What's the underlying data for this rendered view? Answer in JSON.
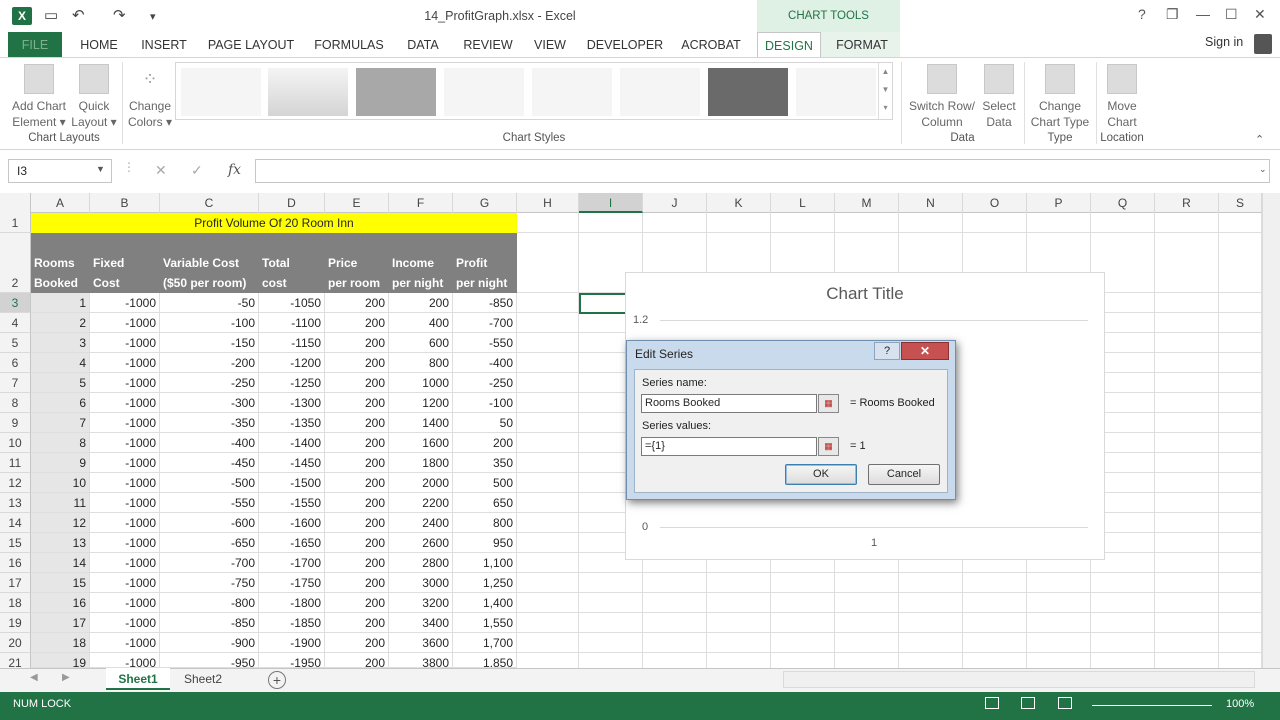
{
  "window": {
    "title": "14_ProfitGraph.xlsx - Excel",
    "chart_tools": "CHART TOOLS",
    "sign_in": "Sign in",
    "controls": {
      "help": "?",
      "restore": "❐",
      "minimize": "—",
      "maximize": "☐",
      "close": "✕"
    }
  },
  "qat": {
    "undo": "↶",
    "redo": "↷",
    "more": "▾",
    "save": "💾"
  },
  "tabs": [
    "FILE",
    "HOME",
    "INSERT",
    "PAGE LAYOUT",
    "FORMULAS",
    "DATA",
    "REVIEW",
    "VIEW",
    "DEVELOPER",
    "ACROBAT",
    "DESIGN",
    "FORMAT"
  ],
  "ribbon": {
    "add_chart": "Add Chart",
    "add_chart2": "Element ▾",
    "quick": "Quick",
    "quick2": "Layout ▾",
    "change": "Change",
    "change2": "Colors ▾",
    "group_layouts": "Chart Layouts",
    "group_styles": "Chart Styles",
    "switch": "Switch Row/",
    "switch2": "Column",
    "select": "Select",
    "select2": "Data",
    "group_data": "Data",
    "ctype": "Change",
    "ctype2": "Chart Type",
    "group_type": "Type",
    "move": "Move",
    "move2": "Chart",
    "group_location": "Location"
  },
  "formula": {
    "name_box": "I3",
    "cancel": "✕",
    "enter": "✓",
    "fx": "fx",
    "value": ""
  },
  "columns": [
    "A",
    "B",
    "C",
    "D",
    "E",
    "F",
    "G",
    "H",
    "I",
    "J",
    "K",
    "L",
    "M",
    "N",
    "O",
    "P",
    "Q",
    "R",
    "S"
  ],
  "sheet": {
    "title": "Profit Volume Of 20 Room Inn",
    "headers": [
      [
        "Rooms",
        "Booked"
      ],
      [
        "Fixed",
        "Cost"
      ],
      [
        "Variable Cost",
        "($50 per room)"
      ],
      [
        "Total",
        "cost"
      ],
      [
        "Price",
        "per room"
      ],
      [
        "Income",
        "per night"
      ],
      [
        "Profit",
        "per night"
      ]
    ],
    "rows": [
      [
        "1",
        "-1000",
        "-50",
        "-1050",
        "200",
        "200",
        "-850"
      ],
      [
        "2",
        "-1000",
        "-100",
        "-1100",
        "200",
        "400",
        "-700"
      ],
      [
        "3",
        "-1000",
        "-150",
        "-1150",
        "200",
        "600",
        "-550"
      ],
      [
        "4",
        "-1000",
        "-200",
        "-1200",
        "200",
        "800",
        "-400"
      ],
      [
        "5",
        "-1000",
        "-250",
        "-1250",
        "200",
        "1000",
        "-250"
      ],
      [
        "6",
        "-1000",
        "-300",
        "-1300",
        "200",
        "1200",
        "-100"
      ],
      [
        "7",
        "-1000",
        "-350",
        "-1350",
        "200",
        "1400",
        "50"
      ],
      [
        "8",
        "-1000",
        "-400",
        "-1400",
        "200",
        "1600",
        "200"
      ],
      [
        "9",
        "-1000",
        "-450",
        "-1450",
        "200",
        "1800",
        "350"
      ],
      [
        "10",
        "-1000",
        "-500",
        "-1500",
        "200",
        "2000",
        "500"
      ],
      [
        "11",
        "-1000",
        "-550",
        "-1550",
        "200",
        "2200",
        "650"
      ],
      [
        "12",
        "-1000",
        "-600",
        "-1600",
        "200",
        "2400",
        "800"
      ],
      [
        "13",
        "-1000",
        "-650",
        "-1650",
        "200",
        "2600",
        "950"
      ],
      [
        "14",
        "-1000",
        "-700",
        "-1700",
        "200",
        "2800",
        "1,100"
      ],
      [
        "15",
        "-1000",
        "-750",
        "-1750",
        "200",
        "3000",
        "1,250"
      ],
      [
        "16",
        "-1000",
        "-800",
        "-1800",
        "200",
        "3200",
        "1,400"
      ],
      [
        "17",
        "-1000",
        "-850",
        "-1850",
        "200",
        "3400",
        "1,550"
      ],
      [
        "18",
        "-1000",
        "-900",
        "-1900",
        "200",
        "3600",
        "1,700"
      ],
      [
        "19",
        "-1000",
        "-950",
        "-1950",
        "200",
        "3800",
        "1,850"
      ]
    ]
  },
  "chart": {
    "title": "Chart Title",
    "y_top": "1.2",
    "y_bottom": "0",
    "x_label": "1"
  },
  "dialog": {
    "title": "Edit Series",
    "help": "?",
    "close": "✕",
    "series_name_label": "Series name:",
    "series_name_value": "Rooms Booked",
    "series_name_eq": "= Rooms Booked",
    "series_values_label": "Series values:",
    "series_values_value": "={1}",
    "series_values_eq": "= 1",
    "ok": "OK",
    "cancel": "Cancel"
  },
  "sheet_tabs": [
    "Sheet1",
    "Sheet2"
  ],
  "status": {
    "text": "NUM LOCK",
    "zoom": "100%"
  }
}
